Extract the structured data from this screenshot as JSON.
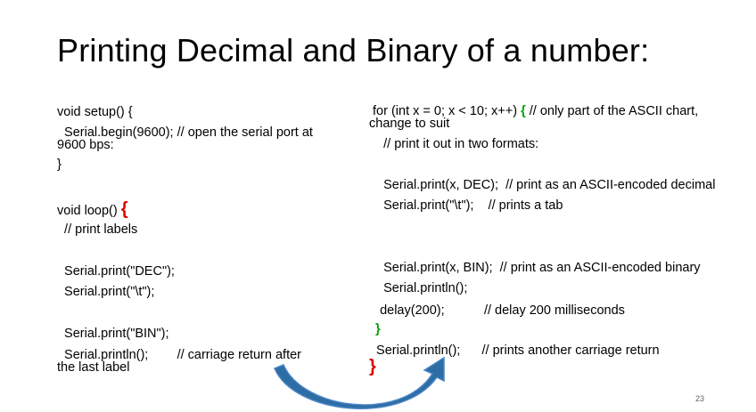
{
  "slide": {
    "title": "Printing Decimal and Binary of a number:",
    "page_number": "23",
    "left_code": {
      "setup_open": "void setup() {",
      "serial_begin": "  Serial.begin(9600); // open the serial port at",
      "serial_begin_cont": "9600 bps:",
      "setup_close": "}",
      "loop_open": "void loop() ",
      "loop_brace": "{",
      "comment_labels": "  // print labels",
      "print_dec": "  Serial.print(\"DEC\");",
      "print_tab": "  Serial.print(\"\\t\");",
      "print_bin": "  Serial.print(\"BIN\");",
      "println_after": "  Serial.println();        // carriage return after",
      "println_after_cont": "the last label"
    },
    "right_code": {
      "for_start": " for (int x = 0; x < 10; x++) ",
      "for_brace": "{",
      "for_comment": " // only part of the ASCII chart,",
      "for_cont": "change to suit",
      "comment_formats": "    // print it out in two formats:",
      "print_x_dec": "    Serial.print(x, DEC);  // print as an ASCII-encoded decimal",
      "print_tab": "    Serial.print(\"\\t\");    // prints a tab",
      "print_x_bin": "    Serial.print(x, BIN);  // print as an ASCII-encoded binary",
      "println": "    Serial.println();",
      "delay": "   delay(200);           // delay 200 milliseconds",
      "close_brace": "}",
      "println_final": "  Serial.println();      // prints another carriage return",
      "final_brace": "}"
    },
    "colors": {
      "brace_red": "#e00000",
      "brace_green": "#00a000",
      "arrow_fill": "#2e6da4",
      "arrow_stroke": "#4a86c8"
    }
  }
}
